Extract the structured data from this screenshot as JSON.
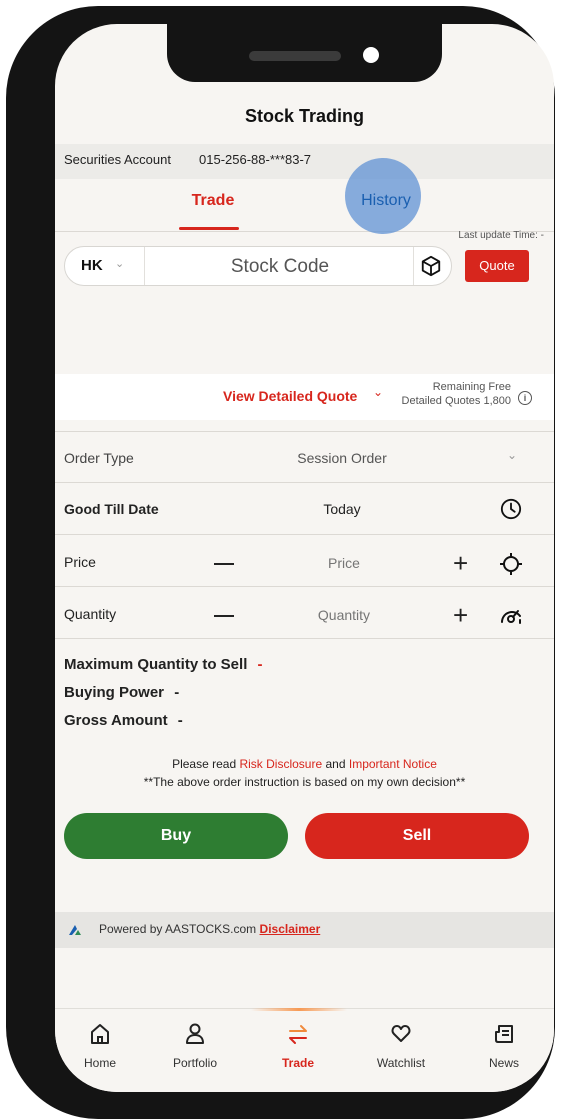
{
  "header": {
    "title": "Stock Trading"
  },
  "account": {
    "label": "Securities Account",
    "number": "015-256-88-***83-7"
  },
  "tabs": [
    {
      "label": "Trade"
    },
    {
      "label": "History"
    }
  ],
  "quote": {
    "last_update": "Last update Time: -",
    "market": "HK",
    "stock_code_placeholder": "Stock Code",
    "quote_button": "Quote"
  },
  "detailed_quote": {
    "label": "View Detailed Quote",
    "remaining_line1": "Remaining Free",
    "remaining_line2": "Detailed Quotes 1,800"
  },
  "order_form": {
    "order_type_label": "Order Type",
    "order_type_value": "Session Order",
    "good_till_label": "Good Till Date",
    "good_till_value": "Today",
    "price_label": "Price",
    "price_placeholder": "Price",
    "quantity_label": "Quantity",
    "quantity_placeholder": "Quantity"
  },
  "summary": {
    "max_qty_label": "Maximum Quantity to Sell",
    "max_qty_value": "-",
    "buying_power_label": "Buying Power",
    "buying_power_value": "-",
    "gross_amount_label": "Gross Amount",
    "gross_amount_value": "-"
  },
  "notice": {
    "prefix": "Please read ",
    "risk_disclosure": "Risk Disclosure",
    "and": " and ",
    "important_notice": "Important Notice",
    "decision": "**The above order instruction is based on my own decision**"
  },
  "actions": {
    "buy": "Buy",
    "sell": "Sell"
  },
  "footer": {
    "powered_by": "Powered by AASTOCKS.com",
    "disclaimer": "Disclaimer"
  },
  "nav": [
    {
      "label": "Home",
      "icon": "home-icon"
    },
    {
      "label": "Portfolio",
      "icon": "person-icon"
    },
    {
      "label": "Trade",
      "icon": "transfer-arrows-icon",
      "active": true
    },
    {
      "label": "Watchlist",
      "icon": "heart-icon"
    },
    {
      "label": "News",
      "icon": "newspaper-icon"
    }
  ],
  "colors": {
    "accent": "#d7261d",
    "buy": "#2e7d32",
    "sell": "#d7261d",
    "background": "#f7f5f2"
  }
}
